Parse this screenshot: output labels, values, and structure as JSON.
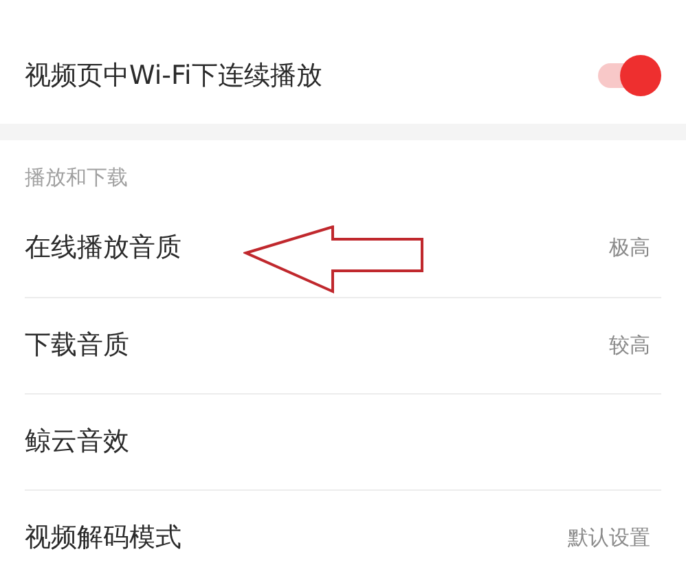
{
  "top_rows": [
    {
      "kind": "toggle",
      "label": "视频页中Wi-Fi下连续播放",
      "on": true
    }
  ],
  "section": {
    "title": "播放和下载",
    "rows": [
      {
        "kind": "value",
        "label": "在线播放音质",
        "value": "极高"
      },
      {
        "kind": "value",
        "label": "下载音质",
        "value": "较高"
      },
      {
        "kind": "plain",
        "label": "鲸云音效"
      },
      {
        "kind": "value",
        "label": "视频解码模式",
        "value": "默认设置"
      }
    ]
  }
}
